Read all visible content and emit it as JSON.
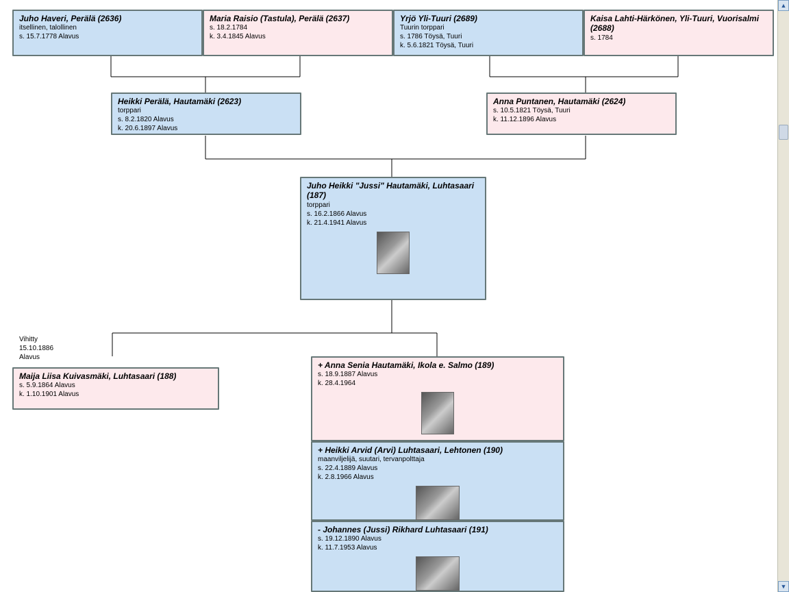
{
  "gen1": {
    "p1": {
      "name": "Juho Haveri, Perälä (2636)",
      "occ": "itsellinen, talollinen",
      "born": "s. 15.7.1778 Alavus"
    },
    "p2": {
      "name": "Maria Raisio (Tastula), Perälä (2637)",
      "born": "s. 18.2.1784",
      "died": "k. 3.4.1845 Alavus"
    },
    "p3": {
      "name": "Yrjö Yli-Tuuri (2689)",
      "occ": "Tuurin torppari",
      "born": "s. 1786 Töysä, Tuuri",
      "died": "k. 5.6.1821 Töysä, Tuuri"
    },
    "p4": {
      "name": "Kaisa Lahti-Härkönen, Yli-Tuuri, Vuorisalmi (2688)",
      "born": "s. 1784"
    }
  },
  "gen2": {
    "p1": {
      "name": "Heikki Perälä, Hautamäki (2623)",
      "occ": "torppari",
      "born": "s. 8.2.1820 Alavus",
      "died": "k. 20.6.1897 Alavus"
    },
    "p2": {
      "name": "Anna Puntanen, Hautamäki (2624)",
      "born": "s. 10.5.1821 Töysä, Tuuri",
      "died": "k. 11.12.1896 Alavus"
    }
  },
  "gen3": {
    "p1": {
      "name": "Juho Heikki \"Jussi\" Hautamäki, Luhtasaari (187)",
      "occ": "torppari",
      "born": "s. 16.2.1866 Alavus",
      "died": "k. 21.4.1941 Alavus"
    }
  },
  "marriage": {
    "line1": "Vihitty",
    "line2": "15.10.1886",
    "line3": "Alavus"
  },
  "spouse": {
    "name": "Maija Liisa Kuivasmäki, Luhtasaari (188)",
    "born": "s. 5.9.1864 Alavus",
    "died": "k. 1.10.1901 Alavus"
  },
  "children": {
    "c1": {
      "name": "+ Anna Senia Hautamäki, Ikola e. Salmo (189)",
      "born": "s. 18.9.1887 Alavus",
      "died": "k. 28.4.1964"
    },
    "c2": {
      "name": "+ Heikki Arvid (Arvi) Luhtasaari, Lehtonen (190)",
      "occ": "maanviljelijä, suutari, tervanpolttaja",
      "born": "s. 22.4.1889 Alavus",
      "died": "k. 2.8.1966 Alavus"
    },
    "c3": {
      "name": "- Johannes (Jussi) Rikhard Luhtasaari (191)",
      "born": "s. 19.12.1890 Alavus",
      "died": "k. 11.7.1953 Alavus"
    }
  },
  "colors": {
    "male": "#cae0f4",
    "female": "#fde9ec",
    "border": "#677"
  }
}
